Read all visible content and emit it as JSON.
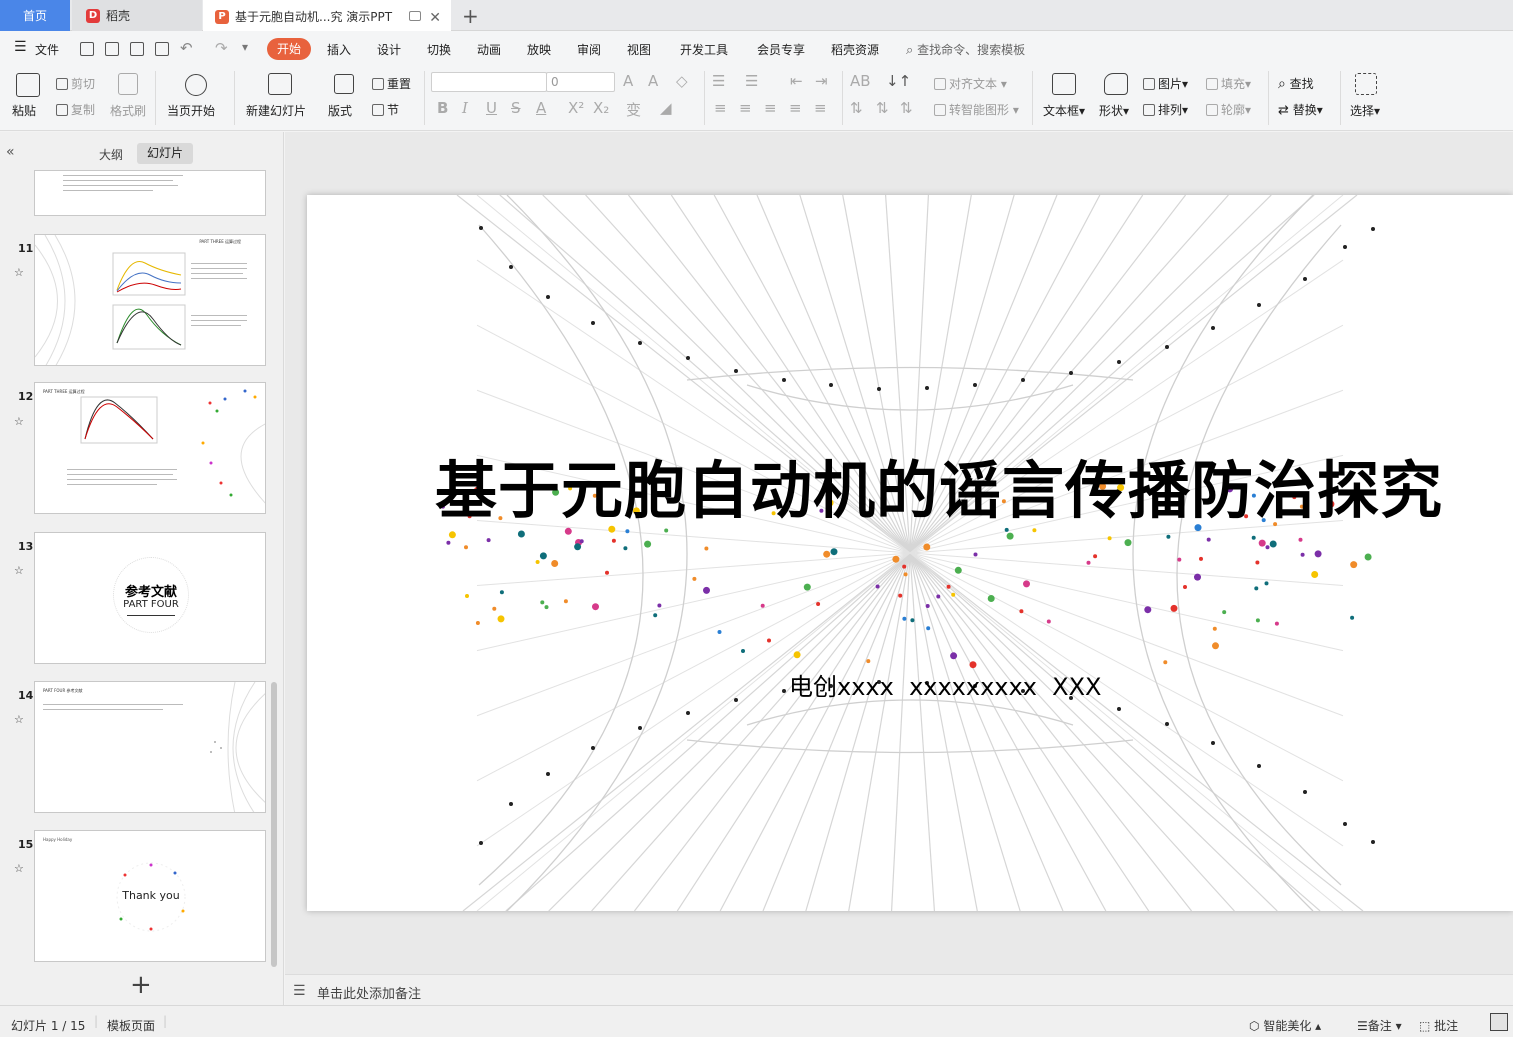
{
  "tabs": {
    "home": "首页",
    "daoke": "稻壳",
    "document": "基于元胞自动机...究 演示PPT"
  },
  "menu": {
    "file": "文件",
    "items": [
      "开始",
      "插入",
      "设计",
      "切换",
      "动画",
      "放映",
      "审阅",
      "视图",
      "开发工具",
      "会员专享",
      "稻壳资源"
    ],
    "search_placeholder": "查找命令、搜索模板"
  },
  "ribbon": {
    "paste": "粘贴",
    "cut": "剪切",
    "copy": "复制",
    "format_painter": "格式刷",
    "from_current": "当页开始",
    "new_slide": "新建幻灯片",
    "layout": "版式",
    "reset": "重置",
    "section": "节",
    "font_size_value": "0",
    "align_text": "对齐文本",
    "smart_art": "转智能图形",
    "text_box": "文本框",
    "shape": "形状",
    "picture": "图片",
    "arrange": "排列",
    "fill": "填充",
    "outline": "轮廓",
    "find": "查找",
    "replace": "替换",
    "select": "选择"
  },
  "panel": {
    "outline_tab": "大纲",
    "slides_tab": "幻灯片"
  },
  "thumbnails": [
    {
      "num": "11",
      "text": "PART THREE 运算过程"
    },
    {
      "num": "12",
      "text": "PART THREE 运算过程"
    },
    {
      "num": "13",
      "title": "参考文献",
      "subtitle": "PART FOUR"
    },
    {
      "num": "14",
      "text": "PART FOUR 参考文献"
    },
    {
      "num": "15",
      "text": "Thank you",
      "corner": "Happy Holiday"
    }
  ],
  "slide": {
    "title": "基于元胞自动机的谣言传播防治探究",
    "subtitle": "电创xxxx  xxxxxxxxx  XXX"
  },
  "notes": {
    "placeholder": "单击此处添加备注"
  },
  "status": {
    "slide_counter": "幻灯片 1 / 15",
    "template": "模板页面",
    "beautify": "智能美化",
    "notes": "备注",
    "comments": "批注"
  },
  "colors": {
    "accent": "#e8623d",
    "home_tab": "#4a86e8"
  }
}
